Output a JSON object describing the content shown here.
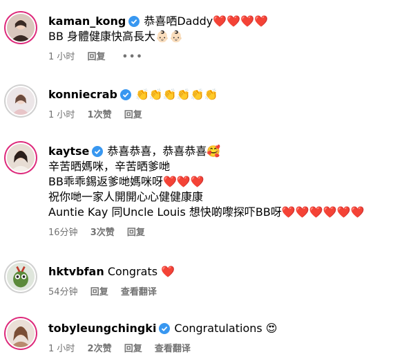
{
  "comments": [
    {
      "username": "kaman_kong",
      "verified": true,
      "lines": [
        "恭喜哂Daddy❤️❤️❤️❤️",
        "BB 身體健康快高長大👶🏻👶🏻"
      ],
      "time": "1 小时",
      "likes": "",
      "reply": "回复",
      "more": "•••",
      "translate": "",
      "avatar_story_ring": true
    },
    {
      "username": "konniecrab",
      "verified": true,
      "lines": [
        "👏👏👏👏👏👏"
      ],
      "time": "1 小时",
      "likes": "1次赞",
      "reply": "回复",
      "more": "",
      "translate": "",
      "avatar_story_ring": false
    },
    {
      "username": "kaytse",
      "verified": true,
      "lines": [
        "恭喜恭喜，恭喜恭喜🥰",
        "辛苦晒媽咪，辛苦晒爹哋",
        "BB乖乖錫返爹哋媽咪呀❤️❤️❤️",
        "祝你哋一家人開開心心健健康康",
        "Auntie Kay 同Uncle Louis 想快啲嚟探吓BB呀❤️❤️❤️❤️❤️❤️"
      ],
      "time": "16分钟",
      "likes": "3次赞",
      "reply": "回复",
      "more": "",
      "translate": "",
      "avatar_story_ring": true
    },
    {
      "username": "hktvbfan",
      "verified": false,
      "lines": [
        "Congrats ❤️"
      ],
      "time": "54分钟",
      "likes": "",
      "reply": "回复",
      "more": "",
      "translate": "查看翻译",
      "avatar_story_ring": false
    },
    {
      "username": "tobyleungchingki",
      "verified": true,
      "lines": [
        "Congratulations 😍"
      ],
      "time": "1 小时",
      "likes": "2次赞",
      "reply": "回复",
      "more": "",
      "translate": "查看翻译",
      "avatar_story_ring": true
    }
  ],
  "colors": {
    "verified": "#3897f0",
    "meta": "#737373",
    "story_ring": "#dd2a7b"
  },
  "icons": {
    "verified": "verified-badge-icon",
    "more": "more-options-icon"
  }
}
